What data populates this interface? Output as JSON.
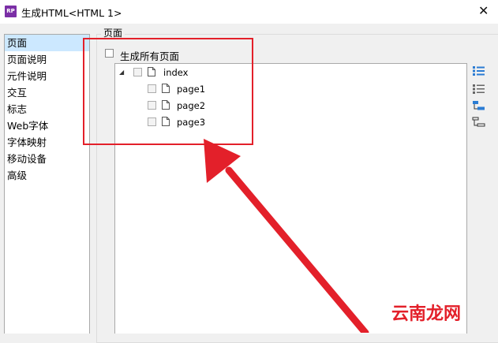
{
  "window": {
    "title": "生成HTML<HTML 1>",
    "app_icon_text": "RP"
  },
  "sidebar": {
    "items": [
      {
        "label": "页面",
        "selected": true
      },
      {
        "label": "页面说明"
      },
      {
        "label": "元件说明"
      },
      {
        "label": "交互"
      },
      {
        "label": "标志"
      },
      {
        "label": "Web字体"
      },
      {
        "label": "字体映射"
      },
      {
        "label": "移动设备"
      },
      {
        "label": "高级"
      }
    ]
  },
  "pages_group": {
    "title": "页面",
    "generate_all_label": "生成所有页面",
    "generate_all_checked": false,
    "tree": {
      "root": {
        "label": "index",
        "expanded": true,
        "checked": false
      },
      "children": [
        {
          "label": "page1",
          "checked": false
        },
        {
          "label": "page2",
          "checked": false
        },
        {
          "label": "page3",
          "checked": false
        }
      ]
    }
  },
  "toolbar_icons": [
    "list-detail-icon",
    "list-icon",
    "tree-expand-icon",
    "tree-collapse-icon"
  ],
  "annotation": {
    "color": "#e3202a"
  },
  "watermark": {
    "text": "云南龙网"
  }
}
